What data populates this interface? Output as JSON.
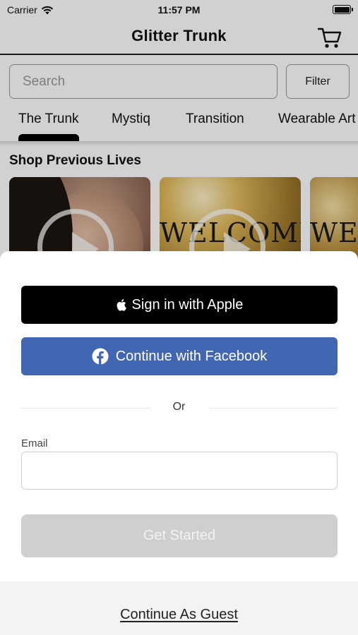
{
  "status_bar": {
    "carrier": "Carrier",
    "time": "11:57 PM"
  },
  "header": {
    "title": "Glitter Trunk",
    "cart_icon": "cart-icon"
  },
  "search": {
    "placeholder": "Search",
    "filter_label": "Filter"
  },
  "tabs": [
    {
      "label": "The Trunk",
      "selected": true
    },
    {
      "label": "Mystiq",
      "selected": false
    },
    {
      "label": "Transition",
      "selected": false
    },
    {
      "label": "Wearable Art",
      "selected": false
    }
  ],
  "section": {
    "title": "Shop Previous Lives",
    "cards": [
      {
        "caption": ""
      },
      {
        "caption": "WELCOME"
      },
      {
        "caption": "WELCOME"
      }
    ]
  },
  "sheet": {
    "apple_label": "Sign in with Apple",
    "facebook_label": "Continue with Facebook",
    "divider_text": "Or",
    "email_label": "Email",
    "email_value": "",
    "get_started_label": "Get Started",
    "guest_label": "Continue As Guest"
  },
  "colors": {
    "apple_button": "#000000",
    "facebook_button": "#4267b2",
    "get_started_disabled": "#cfcfcf",
    "footer_background": "#f3f3f3"
  }
}
